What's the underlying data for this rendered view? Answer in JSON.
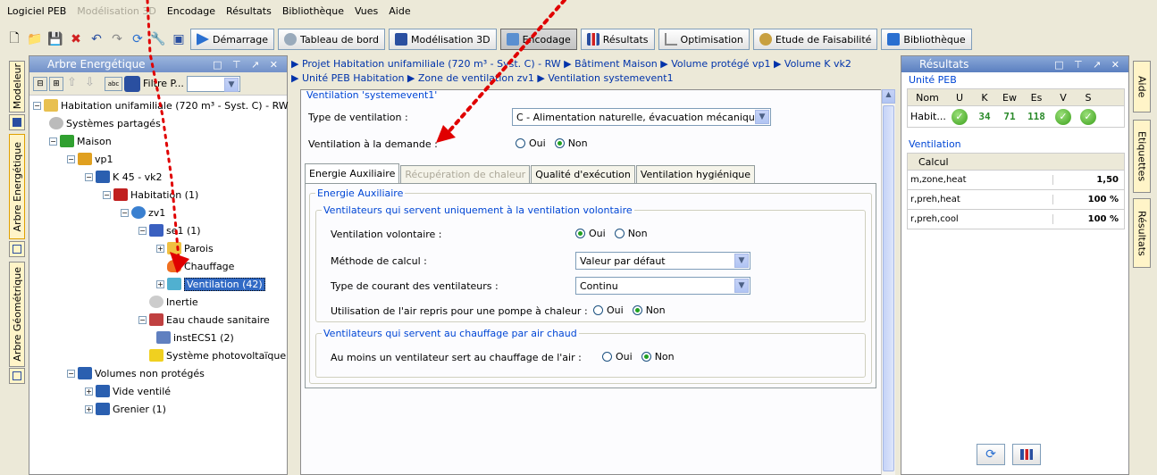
{
  "menu": {
    "items": [
      "Logiciel PEB",
      "Modélisation 3D",
      "Encodage",
      "Résultats",
      "Bibliothèque",
      "Vues",
      "Aide"
    ],
    "disabled_index": 1
  },
  "toolbar": {
    "demarrage": "Démarrage",
    "tableau": "Tableau de bord",
    "modelisation": "Modélisation 3D",
    "encodage": "Encodage",
    "resultats": "Résultats",
    "optimisation": "Optimisation",
    "etude": "Etude de Faisabilité",
    "bibliotheque": "Bibliothèque"
  },
  "side_tabs_left": {
    "modeleur": "Modeleur",
    "arbre_energetique": "Arbre Energétique",
    "arbre_geometrique": "Arbre Géométrique"
  },
  "side_tabs_right": {
    "aide": "Aide",
    "etiquettes": "Etiquettes",
    "resultats": "Résultats"
  },
  "tree_panel": {
    "title": "Arbre Energétique",
    "filter_label": "Filtre P...",
    "items": [
      "Habitation unifamiliale (720 m³ - Syst. C) - RW",
      "Systèmes partagés",
      "Maison",
      "vp1",
      "K 45 - vk2",
      "Habitation (1)",
      "zv1",
      "se1 (1)",
      "Parois",
      "Chauffage",
      "Ventilation (42)",
      "Inertie",
      "Eau chaude sanitaire",
      "instECS1 (2)",
      "Système photovoltaïque",
      "Volumes non protégés",
      "Vide ventilé",
      "Grenier (1)"
    ]
  },
  "breadcrumb": {
    "line1": "▶ Projet Habitation unifamiliale (720 m³ - Syst. C) - RW ▶ Bâtiment Maison ▶ Volume protégé vp1 ▶ Volume K vk2",
    "line2": "▶ Unité PEB Habitation ▶ Zone de ventilation zv1 ▶ Ventilation systemevent1"
  },
  "form": {
    "group_title": "Ventilation 'systemevent1'",
    "type_label": "Type de ventilation :",
    "type_value": "C - Alimentation naturelle, évacuation mécanique",
    "demande_label": "Ventilation à la demande :",
    "oui": "Oui",
    "non": "Non",
    "tabs": [
      "Energie Auxiliaire",
      "Récupération de chaleur",
      "Qualité d'exécution",
      "Ventilation hygiénique"
    ],
    "energie_title": "Energie Auxiliaire",
    "sub1_title": "Ventilateurs qui servent uniquement à la ventilation volontaire",
    "volontaire_label": "Ventilation volontaire :",
    "methode_label": "Méthode de calcul :",
    "methode_value": "Valeur par défaut",
    "courant_label": "Type de courant des ventilateurs :",
    "courant_value": "Continu",
    "air_repris_label": "Utilisation de l'air repris pour une pompe à chaleur :",
    "sub2_title": "Ventilateurs qui servent au chauffage par air chaud",
    "chauffage_label": "Au moins un ventilateur sert au chauffage de l'air :"
  },
  "results_panel": {
    "title": "Résultats",
    "unite_title": "Unité PEB",
    "headers": [
      "Nom",
      "U",
      "K",
      "Ew",
      "Es",
      "V",
      "S"
    ],
    "row": {
      "nom": "Habit...",
      "k": "34",
      "ew": "71",
      "es": "118"
    },
    "ventilation_title": "Ventilation",
    "calcul_header": "Calcul",
    "rows": [
      {
        "label": "m,zone,heat",
        "value": "1,50"
      },
      {
        "label": "r,preh,heat",
        "value": "100 %"
      },
      {
        "label": "r,preh,cool",
        "value": "100 %"
      }
    ]
  },
  "colors": {
    "accent": "#316ac5",
    "title_bar": "#5a7fc0",
    "annotation": "#e00000",
    "group_title": "#0046d5"
  }
}
